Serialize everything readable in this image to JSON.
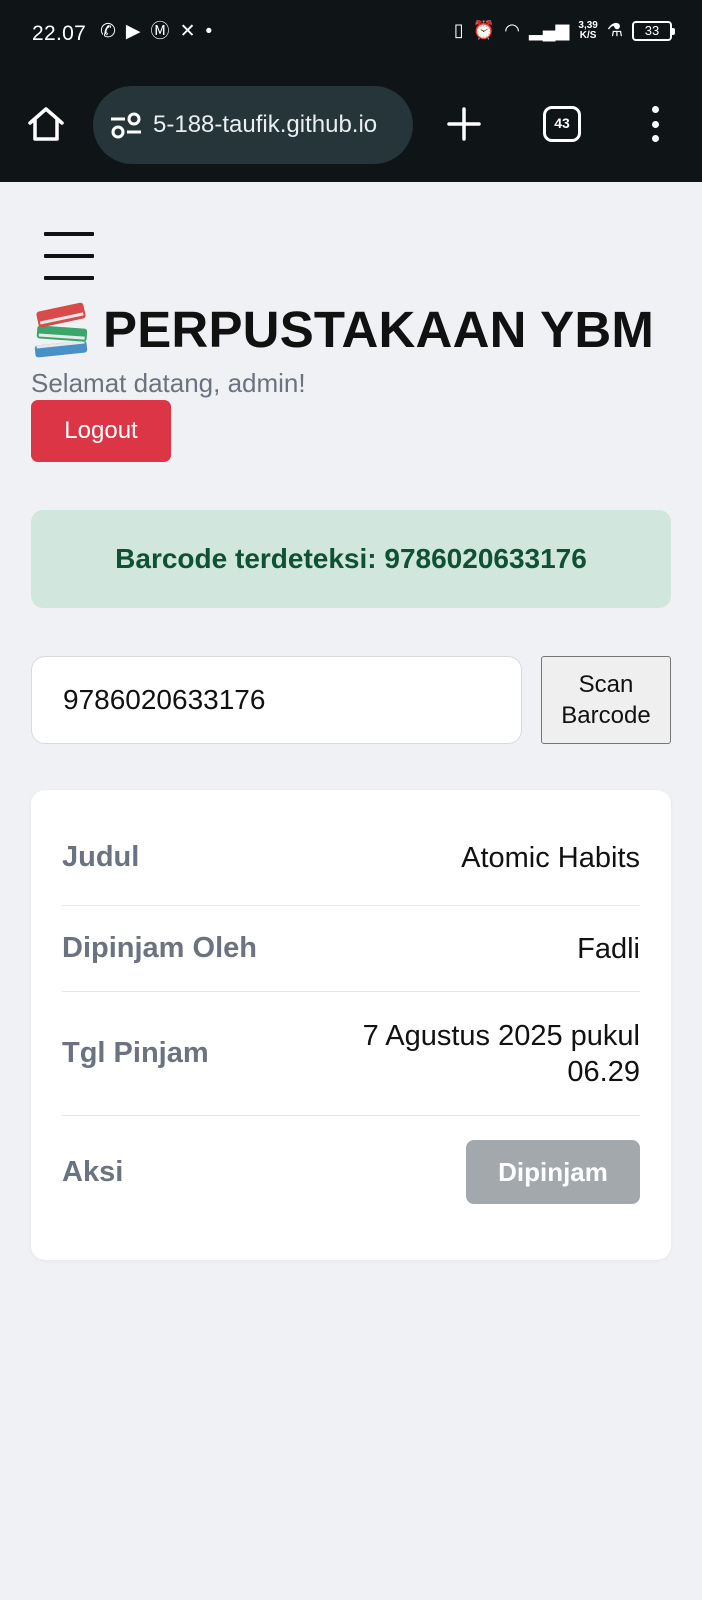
{
  "status_bar": {
    "time": "22.07",
    "speed_top": "3,39",
    "speed_bottom": "K/S",
    "battery": "33"
  },
  "browser": {
    "url": "5-188-taufik.github.io",
    "tab_count": "43"
  },
  "header": {
    "title": "PERPUSTAKAAN YBM",
    "welcome": "Selamat datang, admin!",
    "logout_label": "Logout"
  },
  "alert": {
    "message": "Barcode terdeteksi: 9786020633176",
    "color": "#d1e7dd"
  },
  "scan": {
    "input_value": "9786020633176",
    "button_line1": "Scan",
    "button_line2": "Barcode"
  },
  "book": {
    "rows": [
      {
        "label": "Judul",
        "value": "Atomic Habits"
      },
      {
        "label": "Dipinjam Oleh",
        "value": "Fadli"
      },
      {
        "label": "Tgl Pinjam",
        "value_line1": "7 Agustus 2025 pukul",
        "value_line2": "06.29"
      },
      {
        "label": "Aksi",
        "status": "Dipinjam"
      }
    ]
  },
  "colors": {
    "logout": "#dc3545",
    "status_button": "#a3a8ad",
    "alert_text": "#0f5132"
  }
}
